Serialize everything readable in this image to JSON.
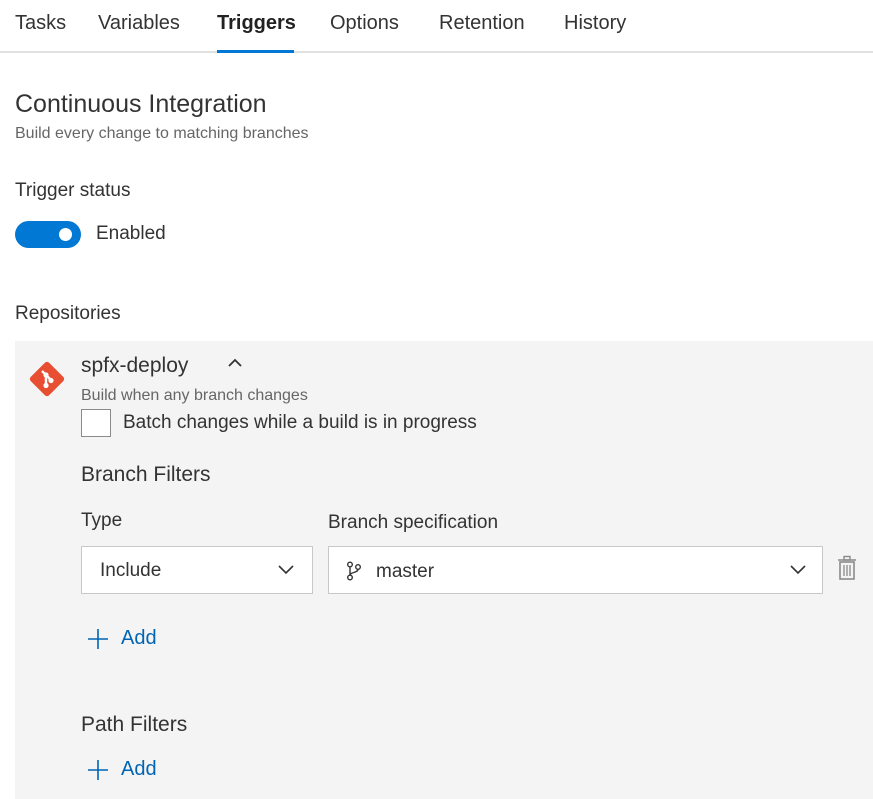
{
  "tabs": [
    {
      "label": "Tasks"
    },
    {
      "label": "Variables"
    },
    {
      "label": "Triggers",
      "active": true
    },
    {
      "label": "Options"
    },
    {
      "label": "Retention"
    },
    {
      "label": "History"
    }
  ],
  "ci": {
    "title": "Continuous Integration",
    "subtitle": "Build every change to matching branches"
  },
  "trigger": {
    "label": "Trigger status",
    "toggle_text": "Enabled",
    "enabled": true
  },
  "repositories": {
    "label": "Repositories",
    "repo": {
      "name": "spfx-deploy",
      "subtitle": "Build when any branch changes",
      "batch_label": "Batch changes while a build is in progress",
      "batch_checked": false
    }
  },
  "branch_filters": {
    "title": "Branch Filters",
    "type_label": "Type",
    "spec_label": "Branch specification",
    "type_value": "Include",
    "spec_value": "master",
    "add_label": "Add"
  },
  "path_filters": {
    "title": "Path Filters",
    "add_label": "Add"
  },
  "colors": {
    "accent": "#0078d4",
    "link": "#0064b4",
    "git_brand": "#e84e31",
    "panel_bg": "#f4f4f4"
  },
  "icons": [
    "git-icon",
    "chevron-up-icon",
    "chevron-down-icon",
    "branch-icon",
    "trash-icon",
    "plus-icon"
  ]
}
